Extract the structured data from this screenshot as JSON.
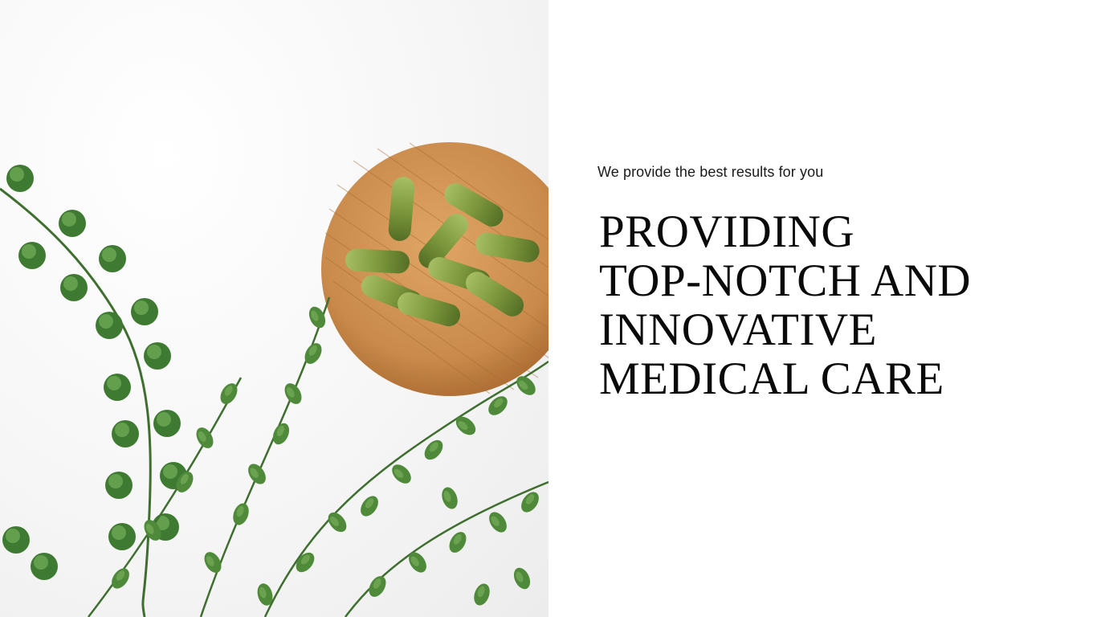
{
  "hero": {
    "image_alt": "Green herbal capsules on a bamboo dish with fern leaves",
    "colors": {
      "background": "#f3f3f3",
      "wood": "#c98a4b",
      "capsule": "#7f9a3e",
      "leaf": "#4f8a3a"
    }
  },
  "content": {
    "tagline": "We provide the best results for you",
    "headline_lines": [
      "PROVIDING",
      "TOP-NOTCH AND",
      "INNOVATIVE",
      "MEDICAL CARE"
    ]
  }
}
